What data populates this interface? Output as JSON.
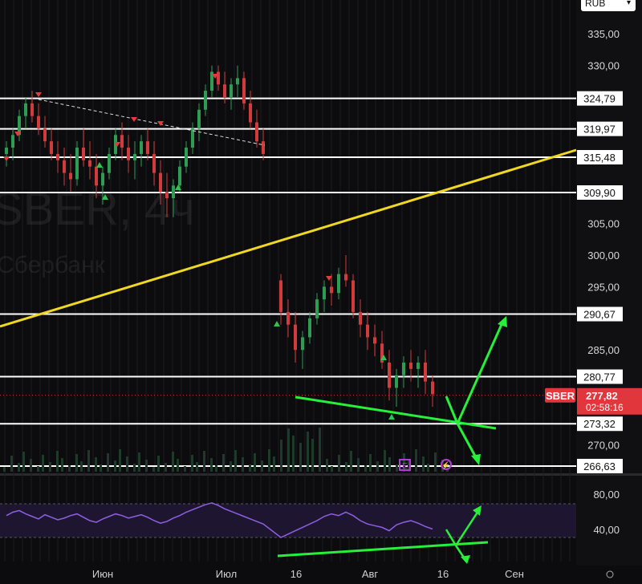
{
  "chart_data": {
    "type": "candlestick",
    "symbol_watermark": "SBER, 4ч",
    "company_watermark": "Сбербанк",
    "currency": "RUB",
    "price_axis": {
      "ylim": [
        265,
        338
      ],
      "ticks": [
        "335,00",
        "330,00",
        "305,00",
        "300,00",
        "295,00",
        "285,00",
        "270,00"
      ]
    },
    "levels": [
      "324,79",
      "319,97",
      "315,48",
      "309,90",
      "290,67",
      "280,77",
      "273,32",
      "266,63"
    ],
    "current_price": {
      "ticker": "SBER",
      "price": "277,82",
      "countdown": "02:58:16",
      "value": 277.82
    },
    "time_axis": [
      "Июн",
      "Июл",
      "16",
      "Авг",
      "16",
      "Сен"
    ],
    "rsi_panel": {
      "ticks": [
        "80,00",
        "40,00"
      ],
      "band": [
        30,
        70
      ]
    },
    "series": [
      {
        "values": [
          [
            316,
            318,
            314,
            317
          ],
          [
            317,
            320,
            315,
            319
          ],
          [
            319,
            323,
            318,
            322
          ],
          [
            322,
            325,
            320,
            324
          ],
          [
            324,
            326,
            321,
            322
          ],
          [
            322,
            324,
            319,
            320
          ],
          [
            320,
            322,
            317,
            318
          ],
          [
            318,
            320,
            315,
            316
          ],
          [
            316,
            318,
            313,
            315
          ],
          [
            315,
            317,
            311,
            313
          ],
          [
            313,
            316,
            310,
            312
          ],
          [
            312,
            318,
            311,
            317
          ],
          [
            317,
            320,
            314,
            315
          ],
          [
            315,
            318,
            312,
            314
          ],
          [
            314,
            316,
            309,
            311
          ],
          [
            311,
            314,
            308,
            313
          ],
          [
            313,
            317,
            312,
            316
          ],
          [
            316,
            320,
            315,
            319
          ],
          [
            319,
            321,
            315,
            317
          ],
          [
            317,
            319,
            313,
            315
          ],
          [
            315,
            318,
            312,
            316
          ],
          [
            316,
            319,
            314,
            318
          ],
          [
            318,
            320,
            315,
            316
          ],
          [
            316,
            318,
            311,
            313
          ],
          [
            313,
            315,
            308,
            310
          ],
          [
            310,
            313,
            306,
            309
          ],
          [
            309,
            312,
            306,
            311
          ],
          [
            311,
            315,
            310,
            314
          ],
          [
            314,
            318,
            313,
            317
          ],
          [
            317,
            321,
            316,
            320
          ],
          [
            320,
            324,
            318,
            323
          ],
          [
            323,
            327,
            322,
            326
          ],
          [
            326,
            330,
            325,
            329
          ],
          [
            329,
            330,
            326,
            327
          ],
          [
            327,
            329,
            324,
            325
          ],
          [
            325,
            328,
            323,
            327
          ],
          [
            327,
            330,
            325,
            328
          ],
          [
            328,
            329,
            323,
            324
          ],
          [
            324,
            326,
            320,
            321
          ],
          [
            321,
            323,
            317,
            318
          ],
          [
            318,
            320,
            315,
            316
          ],
          [
            296,
            297,
            289,
            291
          ],
          [
            291,
            293,
            287,
            289
          ],
          [
            289,
            291,
            283,
            285
          ],
          [
            285,
            288,
            282,
            287
          ],
          [
            287,
            291,
            286,
            290
          ],
          [
            290,
            294,
            289,
            293
          ],
          [
            293,
            296,
            291,
            295
          ],
          [
            295,
            297,
            292,
            294
          ],
          [
            294,
            298,
            293,
            297
          ],
          [
            297,
            300,
            295,
            296
          ],
          [
            296,
            297,
            290,
            291
          ],
          [
            291,
            293,
            287,
            289
          ],
          [
            289,
            291,
            285,
            287
          ],
          [
            287,
            289,
            284,
            286
          ],
          [
            286,
            288,
            282,
            283
          ],
          [
            283,
            285,
            277,
            279
          ],
          [
            279,
            282,
            276,
            281
          ],
          [
            281,
            284,
            279,
            283
          ],
          [
            283,
            285,
            280,
            282
          ],
          [
            282,
            284,
            279,
            283
          ],
          [
            283,
            285,
            278,
            280
          ],
          [
            280,
            281,
            276,
            278
          ]
        ]
      }
    ],
    "rsi_values": [
      56,
      60,
      62,
      58,
      55,
      52,
      57,
      54,
      51,
      53,
      56,
      58,
      54,
      50,
      48,
      52,
      55,
      58,
      56,
      53,
      55,
      57,
      54,
      50,
      47,
      49,
      53,
      56,
      60,
      63,
      66,
      69,
      71,
      68,
      64,
      61,
      58,
      55,
      52,
      49,
      46,
      30,
      34,
      38,
      42,
      46,
      50,
      55,
      58,
      56,
      60,
      56,
      50,
      46,
      44,
      42,
      38,
      45,
      48,
      50,
      47,
      43,
      40
    ],
    "labels": {
      "markers": [
        "E",
        "⚡"
      ]
    }
  }
}
